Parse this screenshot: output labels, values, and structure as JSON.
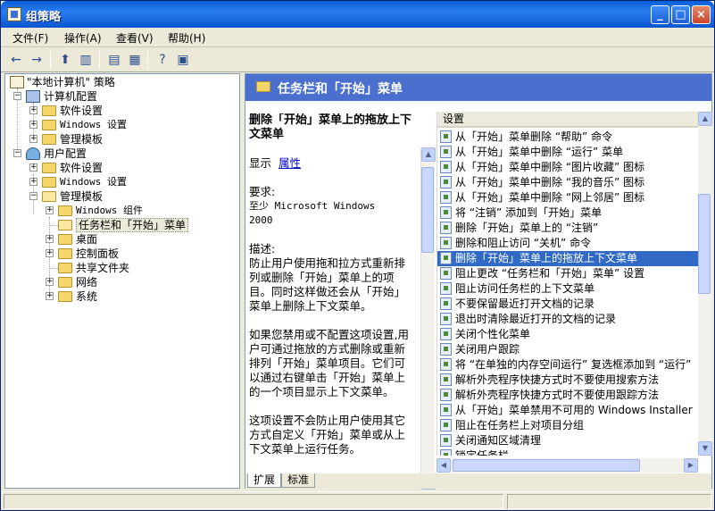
{
  "window": {
    "title": "组策略"
  },
  "menu": [
    "文件(F)",
    "操作(A)",
    "查看(V)",
    "帮助(H)"
  ],
  "tree": {
    "root": "\"本地计算机\" 策略",
    "computer_config": "计算机配置",
    "c_software": "软件设置",
    "c_windows": "Windows 设置",
    "c_admin": "管理模板",
    "user_config": "用户配置",
    "u_software": "软件设置",
    "u_windows": "Windows 设置",
    "u_admin": "管理模板",
    "windows_components": "Windows 组件",
    "taskbar_start": "任务栏和「开始」菜单",
    "desktop": "桌面",
    "control_panel": "控制面板",
    "shared_folders": "共享文件夹",
    "network": "网络",
    "system": "系统"
  },
  "right_header": "任务栏和「开始」菜单",
  "description": {
    "title": "删除「开始」菜单上的拖放上下文菜单",
    "show_label": "显示",
    "properties_link": "属性",
    "requirements_label": "要求:",
    "requirements_value_line1": "至少 Microsoft Windows",
    "requirements_value_line2": "2000",
    "desc_label": "描述:",
    "para1": "防止用户使用拖和拉方式重新排列或删除「开始」菜单上的项目。同时这样做还会从「开始」菜单上删除上下文菜单。",
    "para2": "如果您禁用或不配置这项设置,用户可通过拖放的方式删除或重新排列「开始」菜单项目。它们可以通过右键单击「开始」菜单上的一个项目显示上下文菜单。",
    "para3": "这项设置不会防止用户使用其它方式自定义「开始」菜单或从上下文菜单上运行任务。"
  },
  "list": {
    "header": "设置",
    "items": [
      "从「开始」菜单删除 “帮助” 命令",
      "从「开始」菜单中删除 “运行” 菜单",
      "从「开始」菜单中删除 “图片收藏” 图标",
      "从「开始」菜单中删除 “我的音乐” 图标",
      "从「开始」菜单中删除 “网上邻居” 图标",
      "将 “注销” 添加到「开始」菜单",
      "删除「开始」菜单上的 “注销”",
      "删除和阻止访问 “关机” 命令",
      "删除「开始」菜单上的拖放上下文菜单",
      "阻止更改 “任务栏和「开始」菜单” 设置",
      "阻止访问任务栏的上下文菜单",
      "不要保留最近打开文档的记录",
      "退出时清除最近打开的文档的记录",
      "关闭个性化菜单",
      "关闭用户跟踪",
      "将 “在单独的内存空间运行” 复选框添加到 “运行”",
      "解析外壳程序快捷方式时不要使用搜索方法",
      "解析外壳程序快捷方式时不要使用跟踪方法",
      "从「开始」菜单禁用不可用的 Windows Installer",
      "阻止在任务栏上对项目分组",
      "关闭通知区域清理",
      "锁定任务栏"
    ],
    "selected_index": 8
  },
  "tabs": [
    "扩展",
    "标准"
  ]
}
